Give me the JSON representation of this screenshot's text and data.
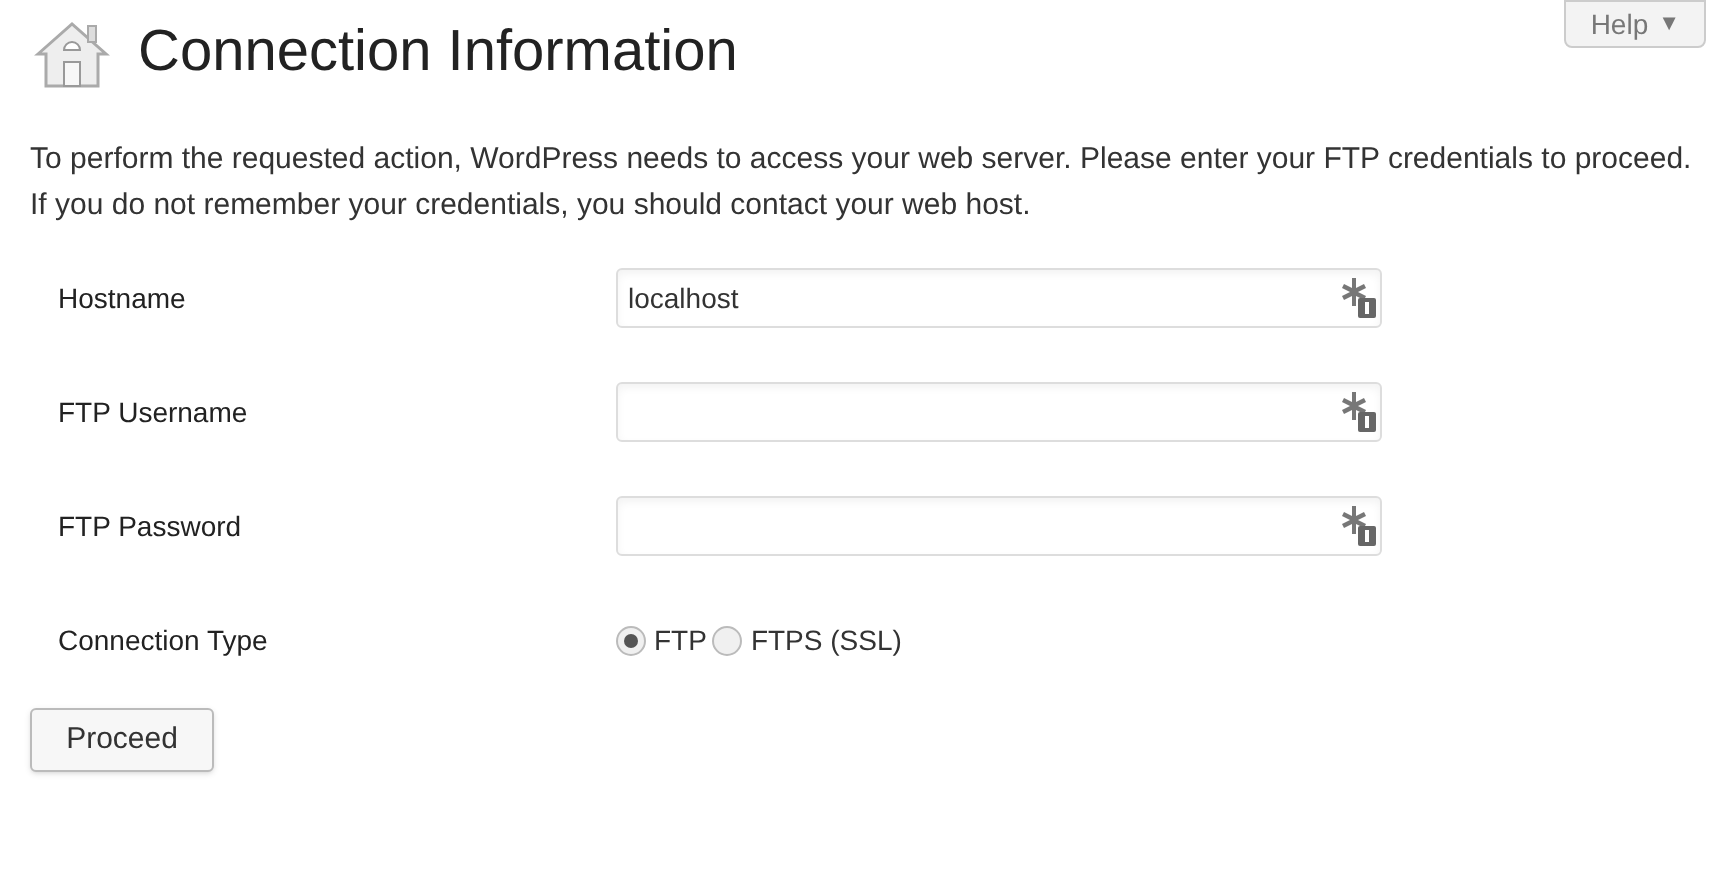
{
  "help_button": {
    "label": "Help",
    "caret": "▼"
  },
  "title": "Connection Information",
  "intro": "To perform the requested action, WordPress needs to access your web server. Please enter your FTP credentials to proceed. If you do not remember your credentials, you should contact your web host.",
  "fields": [
    {
      "label": "Hostname",
      "value": "localhost"
    },
    {
      "label": "FTP Username"
    },
    {
      "label": "FTP Password"
    }
  ],
  "connection_type": {
    "label": "Connection Type",
    "options": [
      {
        "label": "FTP",
        "selected": true
      },
      {
        "label": "FTPS (SSL)",
        "selected": false
      }
    ]
  },
  "submit": "Proceed"
}
